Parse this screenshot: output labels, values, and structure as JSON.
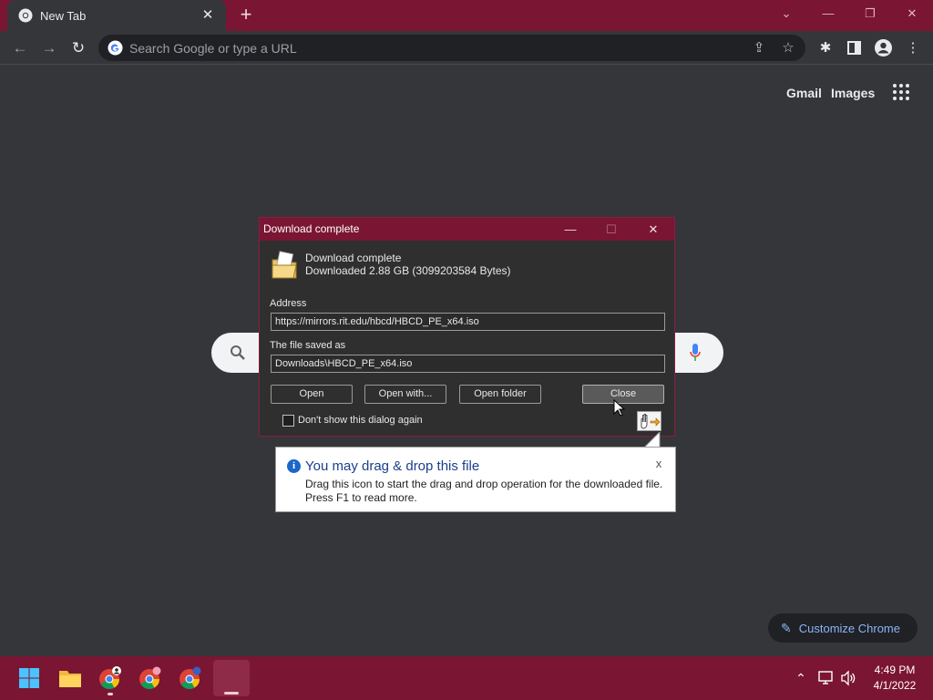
{
  "browser": {
    "tab": {
      "title": "New Tab",
      "close_glyph": "✕"
    },
    "new_tab_glyph": "+",
    "omnibox": {
      "placeholder": "Search Google or type a URL"
    }
  },
  "ntp": {
    "gmail_label": "Gmail",
    "images_label": "Images",
    "customize_label": "Customize Chrome"
  },
  "dialog": {
    "title": "Download complete",
    "heading": "Download complete",
    "size_text": "Downloaded 2.88  GB (3099203584 Bytes)",
    "address_label": "Address",
    "address_value": "https://mirrors.rit.edu/hbcd/HBCD_PE_x64.iso",
    "saved_label": "The file saved as",
    "saved_value": "Downloads\\HBCD_PE_x64.iso",
    "buttons": {
      "open": "Open",
      "open_with": "Open with...",
      "open_folder": "Open folder",
      "close": "Close"
    },
    "checkbox_label": "Don't show this dialog again"
  },
  "balloon": {
    "title": "You may drag & drop this file",
    "line1": "Drag this icon to start the drag and drop operation for the downloaded file.",
    "line2": "Press F1 to read more.",
    "close_glyph": "x"
  },
  "taskbar": {
    "time": "4:49 PM",
    "date": "4/1/2022"
  },
  "colors": {
    "accent": "#7a1533",
    "page_bg": "#35363a",
    "link_blue": "#8ab4f8"
  },
  "icons": [
    "chrome-icon",
    "back-icon",
    "forward-icon",
    "reload-icon",
    "google-g-icon",
    "share-icon",
    "star-icon",
    "extensions-icon",
    "side-panel-icon",
    "profile-icon",
    "menu-icon",
    "apps-icon",
    "search-icon",
    "mic-icon",
    "pencil-icon",
    "download-folder-icon",
    "drag-handle-icon",
    "info-icon",
    "windows-start-icon",
    "file-explorer-icon",
    "chevron-up-icon",
    "network-icon",
    "volume-icon"
  ]
}
